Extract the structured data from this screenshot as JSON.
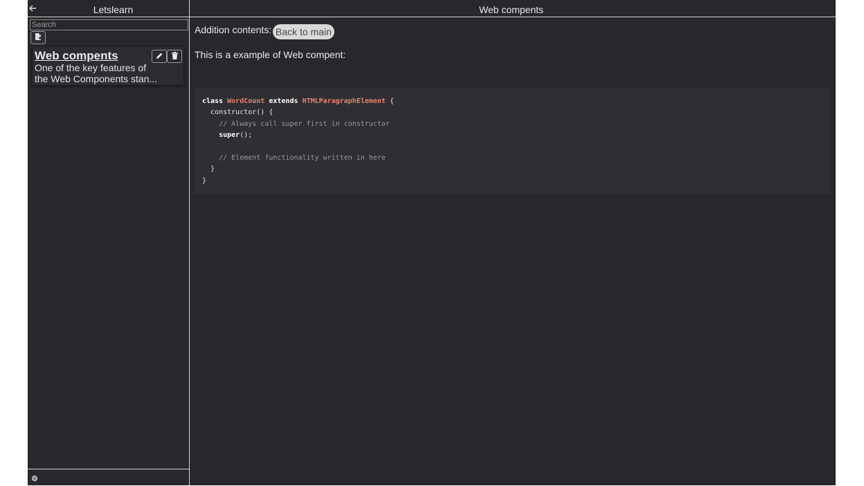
{
  "sidebar": {
    "title": "Letslearn",
    "back_icon": "arrow-left-icon",
    "search_placeholder": "Search",
    "new_note_icon": "new-note-icon",
    "notes": [
      {
        "title": "Web compents",
        "snippet_line1": "One of the key features of",
        "snippet_line2": "the Web Components stan...",
        "edit_icon": "pencil-icon",
        "delete_icon": "trash-icon"
      }
    ],
    "settings_icon": "gear-icon"
  },
  "main": {
    "title": "Web compents",
    "addition_label": "Addition contents:",
    "back_to_main_label": "Back to main",
    "intro": "This is a example of Web compent:",
    "code": {
      "kw_class": "class",
      "class_name": "WordCount",
      "kw_extends": "extends",
      "parent_class": "HTMLParagraphElement",
      "open_brace": "{",
      "constructor_line": "constructor() {",
      "comment1": "// Always call super first in constructor",
      "kw_super": "super",
      "super_rest": "();",
      "comment2": "// Element functionality written in here",
      "close_inner": "}",
      "close_outer": "}"
    }
  },
  "colors": {
    "background": "#28272b",
    "code_background": "#2f2f33",
    "class_name": "#e8806c",
    "button_bg": "#d9d9d9"
  }
}
